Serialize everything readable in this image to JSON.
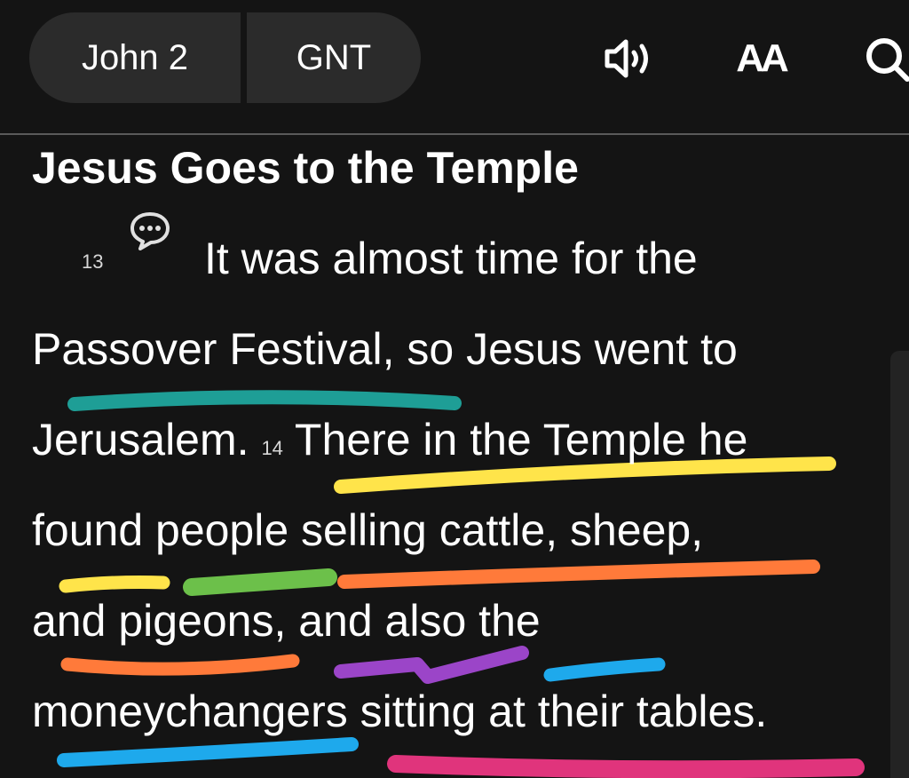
{
  "toolbar": {
    "book_chapter": "John 2",
    "version": "GNT",
    "audio_icon": "speaker-icon",
    "font_size_label": "AA",
    "search_icon": "search-icon"
  },
  "passage": {
    "heading": "Jesus Goes to the Temple",
    "verse_13_number": "13",
    "verse_14_number": "14",
    "lines": [
      "It was almost time for the",
      "Passover Festival, so Jesus went to",
      "Jerusalem.",
      "There in the Temple he",
      "found people selling cattle, sheep,",
      "and pigeons, and also the",
      "moneychangers sitting at their tables."
    ]
  },
  "highlight_colors": {
    "teal": "#1e9e96",
    "yellow": "#ffe44a",
    "green": "#6cc04a",
    "orange": "#ff7a3a",
    "purple": "#9b45c8",
    "blue": "#1ea9ec",
    "pink": "#e0347c"
  }
}
